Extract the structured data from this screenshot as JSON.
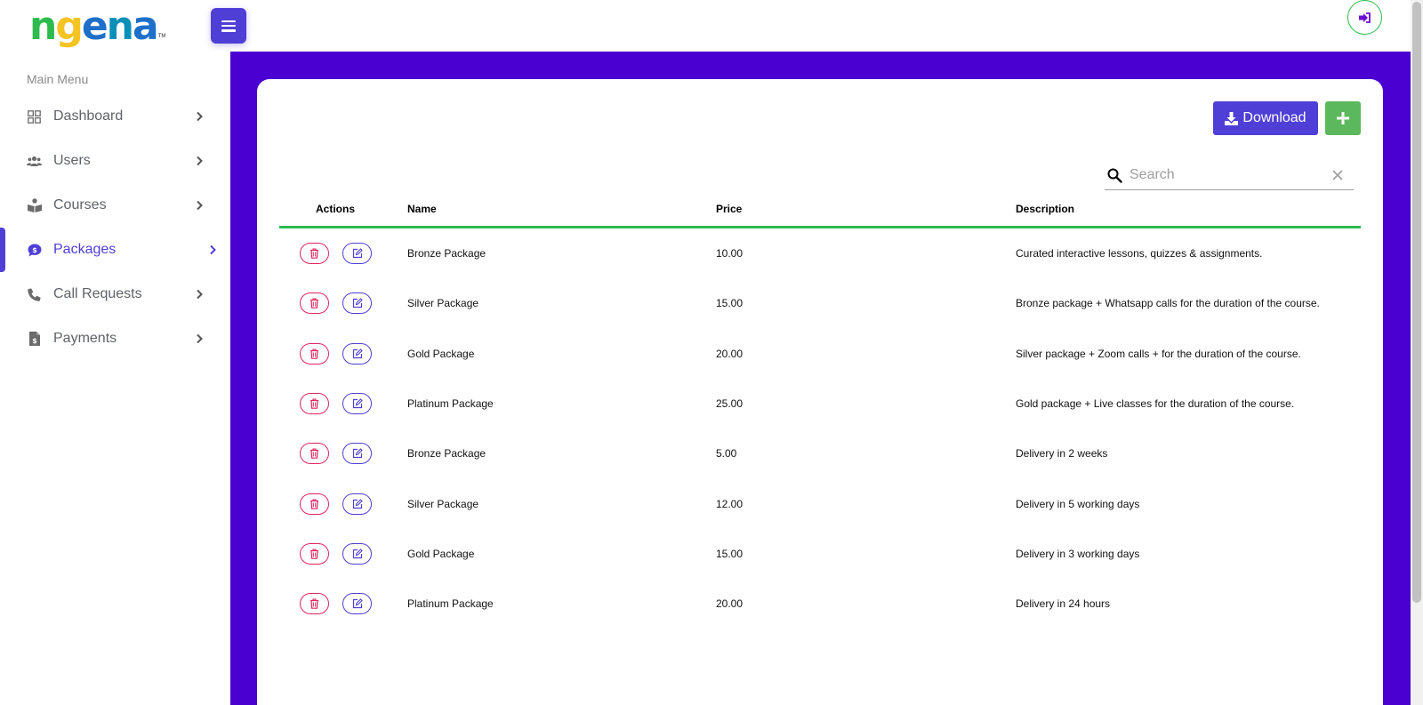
{
  "brand": {
    "logo_parts": [
      "n",
      "g",
      "e",
      "n",
      "a"
    ],
    "logo_tm": "TM",
    "colors": {
      "green": "#2dbb4e",
      "yellow": "#f5c423",
      "blue": "#1d6fc9",
      "teal": "#0a8fb8"
    }
  },
  "header": {
    "menu_toggle_icon": "hamburger-icon",
    "logout_icon": "sign-out-icon"
  },
  "sidebar": {
    "title": "Main Menu",
    "items": [
      {
        "label": "Dashboard",
        "icon": "grid-icon",
        "active": false
      },
      {
        "label": "Users",
        "icon": "users-icon",
        "active": false
      },
      {
        "label": "Courses",
        "icon": "book-reader-icon",
        "active": false
      },
      {
        "label": "Packages",
        "icon": "dollar-comment-icon",
        "active": true
      },
      {
        "label": "Call Requests",
        "icon": "phone-icon",
        "active": false
      },
      {
        "label": "Payments",
        "icon": "invoice-dollar-icon",
        "active": false
      }
    ]
  },
  "toolbar": {
    "download_label": "Download",
    "add_icon": "plus-icon"
  },
  "search": {
    "placeholder": "Search",
    "value": ""
  },
  "table": {
    "columns": [
      "Actions",
      "Name",
      "Price",
      "Description"
    ],
    "rows": [
      {
        "name": "Bronze Package",
        "price": "10.00",
        "description": "Curated interactive lessons, quizzes & assignments."
      },
      {
        "name": "Silver Package",
        "price": "15.00",
        "description": "Bronze package + Whatsapp calls for the duration of the course."
      },
      {
        "name": "Gold Package",
        "price": "20.00",
        "description": "Silver package + Zoom calls + for the duration of the course."
      },
      {
        "name": "Platinum Package",
        "price": "25.00",
        "description": "Gold package + Live classes for the duration of the course."
      },
      {
        "name": "Bronze Package",
        "price": "5.00",
        "description": "Delivery in 2 weeks"
      },
      {
        "name": "Silver Package",
        "price": "12.00",
        "description": "Delivery in 5 working days"
      },
      {
        "name": "Gold Package",
        "price": "15.00",
        "description": "Delivery in 3 working days"
      },
      {
        "name": "Platinum Package",
        "price": "20.00",
        "description": "Delivery in 24 hours"
      }
    ]
  },
  "theme": {
    "primary": "#4f3fd6",
    "main_background": "#4a00d1",
    "success": "#5cb85c",
    "danger": "#e0245e"
  }
}
